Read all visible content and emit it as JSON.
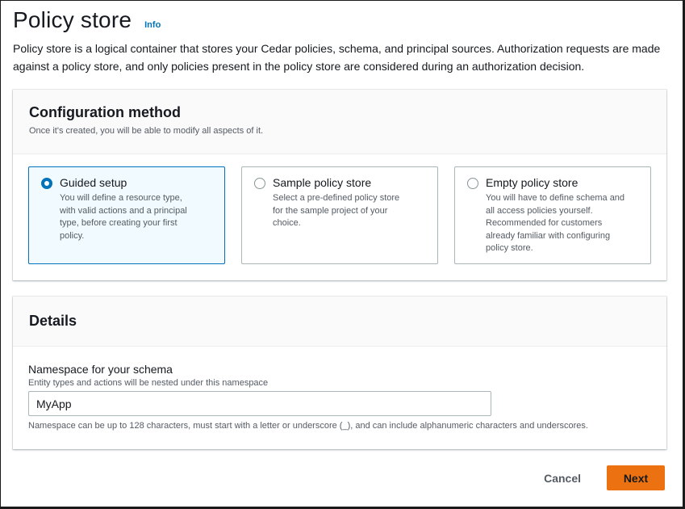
{
  "header": {
    "title": "Policy store",
    "info_label": "Info",
    "description": "Policy store is a logical container that stores your Cedar policies, schema, and principal sources. Authorization requests are made against a policy store, and only policies present in the policy store are considered during an authorization decision."
  },
  "configuration": {
    "title": "Configuration method",
    "description": "Once it's created, you will be able to modify all aspects of it.",
    "selected": "guided-setup",
    "options": [
      {
        "id": "guided-setup",
        "label": "Guided setup",
        "description_lines": [
          "You will define a resource type,",
          "with valid actions and a principal",
          "type, before creating your first",
          "policy."
        ]
      },
      {
        "id": "sample-policy-store",
        "label": "Sample policy store",
        "description_lines": [
          "Select a pre-defined policy store",
          "for the sample project of your",
          "choice."
        ]
      },
      {
        "id": "empty-policy-store",
        "label": "Empty policy store",
        "description_lines": [
          "You will have to define schema and",
          "all access policies yourself.",
          "Recommended for customers",
          "already familiar with configuring",
          "policy store."
        ]
      }
    ]
  },
  "details": {
    "title": "Details",
    "namespace": {
      "label": "Namespace for your schema",
      "description": "Entity types and actions will be nested under this namespace",
      "value": "MyApp",
      "constraint": "Namespace can be up to 128 characters, must start with a letter or underscore (_), and can include alphanumeric characters and underscores."
    }
  },
  "actions": {
    "cancel_label": "Cancel",
    "next_label": "Next"
  },
  "colors": {
    "accent": "#0073bb",
    "primary_button": "#ec7211",
    "selected_tile_bg": "#f1faff"
  }
}
